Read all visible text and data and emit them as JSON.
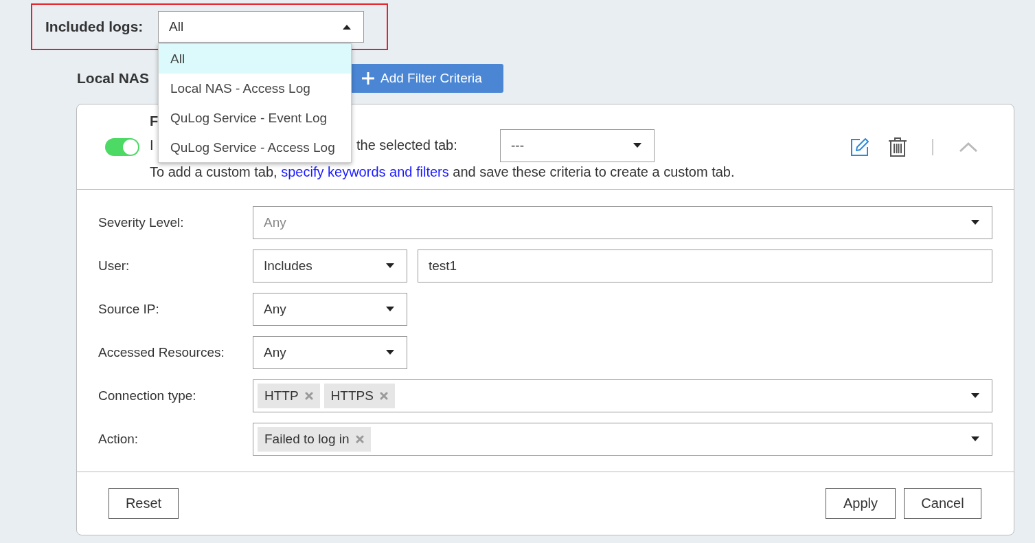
{
  "included_logs": {
    "label": "Included logs:",
    "value": "All",
    "expanded": true,
    "options": [
      {
        "label": "All",
        "selected": true
      },
      {
        "label": "Local NAS - Access Log",
        "selected": false
      },
      {
        "label": "QuLog Service - Event Log",
        "selected": false
      },
      {
        "label": "QuLog Service - Access Log",
        "selected": false
      }
    ]
  },
  "section": {
    "title": "Local NAS",
    "add_button": "Add Filter Criteria"
  },
  "filter": {
    "title": "F",
    "enabled": true,
    "expanded": true,
    "intro_start": "I",
    "intro_end": "the selected tab:",
    "tab_select": "---",
    "hint_before": "To add a custom tab, ",
    "hint_link": "specify keywords and filters",
    "hint_after": " and save these criteria to create a custom tab.",
    "fields": [
      {
        "kind": "select",
        "label": "Severity Level:",
        "placeholder": "Any"
      },
      {
        "kind": "select_text",
        "label": "User:",
        "operator": "Includes",
        "value": "test1"
      },
      {
        "kind": "select_short",
        "label": "Source IP:",
        "value": "Any"
      },
      {
        "kind": "select_short",
        "label": "Accessed Resources:",
        "value": "Any"
      },
      {
        "kind": "tags",
        "label": "Connection type:",
        "tags": [
          "HTTP",
          "HTTPS"
        ]
      },
      {
        "kind": "tags",
        "label": "Action:",
        "tags": [
          "Failed to log in"
        ]
      }
    ]
  },
  "buttons": {
    "reset": "Reset",
    "apply": "Apply",
    "cancel": "Cancel"
  }
}
